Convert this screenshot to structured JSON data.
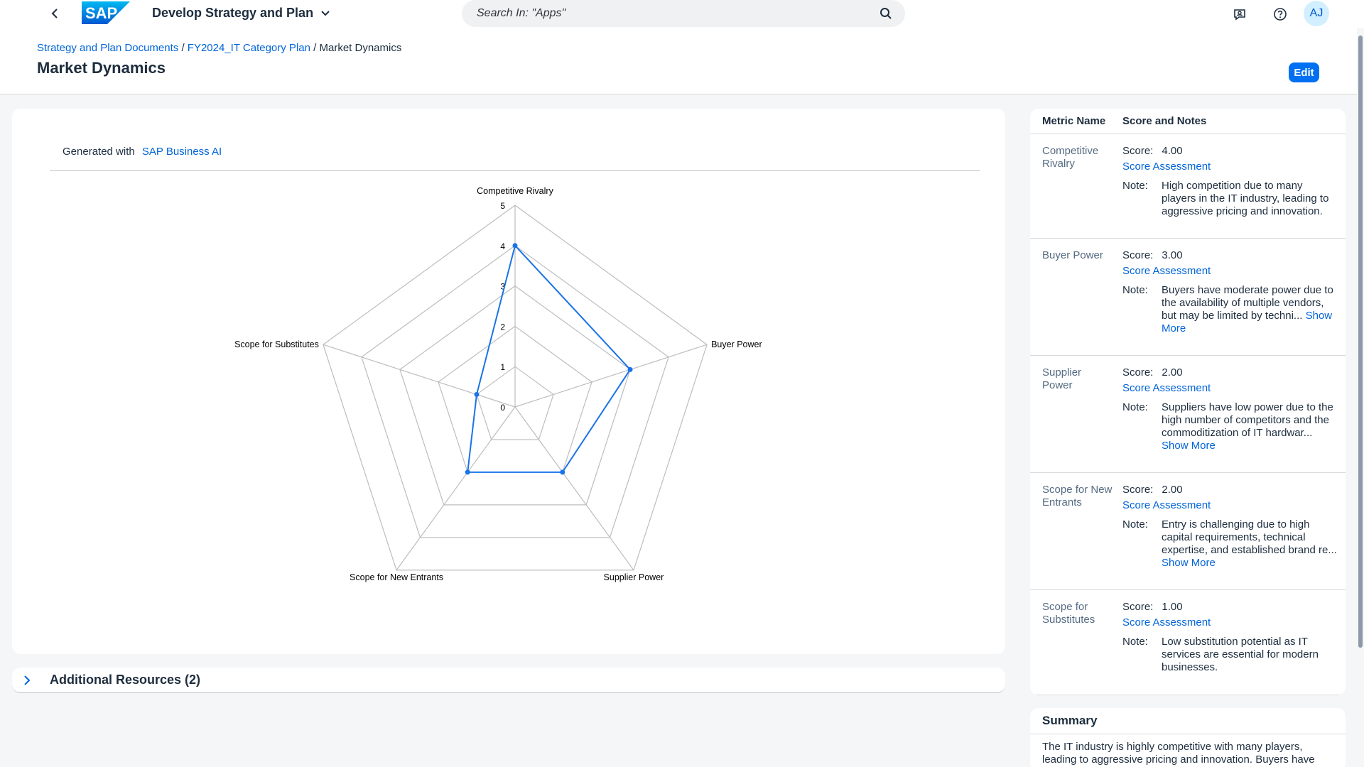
{
  "shell": {
    "app_title": "Develop Strategy and Plan",
    "search_placeholder": "Search In: \"Apps\"",
    "avatar_initials": "AJ",
    "brand_color": "#0070f2"
  },
  "header": {
    "breadcrumb": [
      {
        "label": "Strategy and Plan Documents"
      },
      {
        "label": "FY2024_IT Category Plan"
      },
      {
        "label": "Market Dynamics"
      }
    ],
    "separator": "/",
    "title": "Market Dynamics",
    "edit_label": "Edit"
  },
  "chart_card": {
    "generated_prefix": "Generated with",
    "generated_link": "SAP Business AI"
  },
  "chart_data": {
    "type": "radar",
    "axes": [
      "Competitive Rivalry",
      "Buyer Power",
      "Supplier Power",
      "Scope for New Entrants",
      "Scope for Substitutes"
    ],
    "values": [
      4,
      3,
      2,
      2,
      1
    ],
    "rlim": [
      0,
      5
    ],
    "ticks": [
      "0",
      "1",
      "2",
      "3",
      "4",
      "5"
    ],
    "series_color": "#1a73e8",
    "grid": true
  },
  "resources": {
    "title": "Additional Resources (2)"
  },
  "metrics": {
    "col_metric": "Metric Name",
    "col_score": "Score and Notes",
    "score_label": "Score:",
    "assessment_label": "Score Assessment",
    "note_label": "Note:",
    "show_more": "Show More",
    "rows": [
      {
        "name": "Competitive Rivalry",
        "score": "4.00",
        "note": "High competition due to many players in the IT industry, leading to aggressive pricing and innovation.",
        "truncated": false
      },
      {
        "name": "Buyer Power",
        "score": "3.00",
        "note": "Buyers have moderate power due to the availability of multiple vendors, but may be limited by techni...",
        "truncated": true
      },
      {
        "name": "Supplier Power",
        "score": "2.00",
        "note": "Suppliers have low power due to the high number of competitors and the commoditization of IT hardwar...",
        "truncated": true
      },
      {
        "name": "Scope for New Entrants",
        "score": "2.00",
        "note": "Entry is challenging due to high capital requirements, technical expertise, and established brand re...",
        "truncated": true
      },
      {
        "name": "Scope for Substitutes",
        "score": "1.00",
        "note": "Low substitution potential as IT services are essential for modern businesses.",
        "truncated": false
      }
    ]
  },
  "summary": {
    "title": "Summary",
    "text": "The IT industry is highly competitive with many players, leading to aggressive pricing and innovation. Buyers have"
  }
}
